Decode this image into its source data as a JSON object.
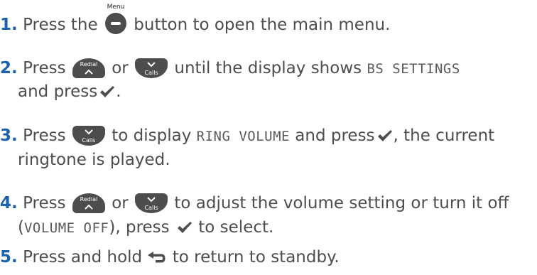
{
  "colors": {
    "number": "#1a62ad",
    "text": "#4d4d4f",
    "button": "#4d4d4f"
  },
  "buttons": {
    "menu_caption": "Menu",
    "redial_label": "Redial",
    "calls_label": "Calls"
  },
  "icons": {
    "menu_button": "menu-button-icon",
    "redial_up": "redial-up-button-icon",
    "calls_down": "calls-down-button-icon",
    "ok": "checkmark-icon",
    "back": "back-arrow-icon"
  },
  "steps": [
    {
      "number": "1.",
      "t1": "Press the",
      "t2": "button to open the main menu."
    },
    {
      "number": "2.",
      "t1": "Press",
      "t2": "or",
      "t3": "until the display shows",
      "lcd": "BS SETTINGS",
      "t4": "and press",
      "t5": "."
    },
    {
      "number": "3.",
      "t1": "Press",
      "t2": "to display",
      "lcd": "RING VOLUME",
      "t3": "and press",
      "t4": ", the current",
      "t5": "ringtone is played."
    },
    {
      "number": "4.",
      "t1": "Press",
      "t2": "or",
      "t3": "to adjust the volume setting or turn it off",
      "t4": "(",
      "lcd": "VOLUME OFF",
      "t5": "), press",
      "t6": "to select."
    },
    {
      "number": "5.",
      "t1": "Press and hold",
      "t2": "to return to standby."
    }
  ]
}
